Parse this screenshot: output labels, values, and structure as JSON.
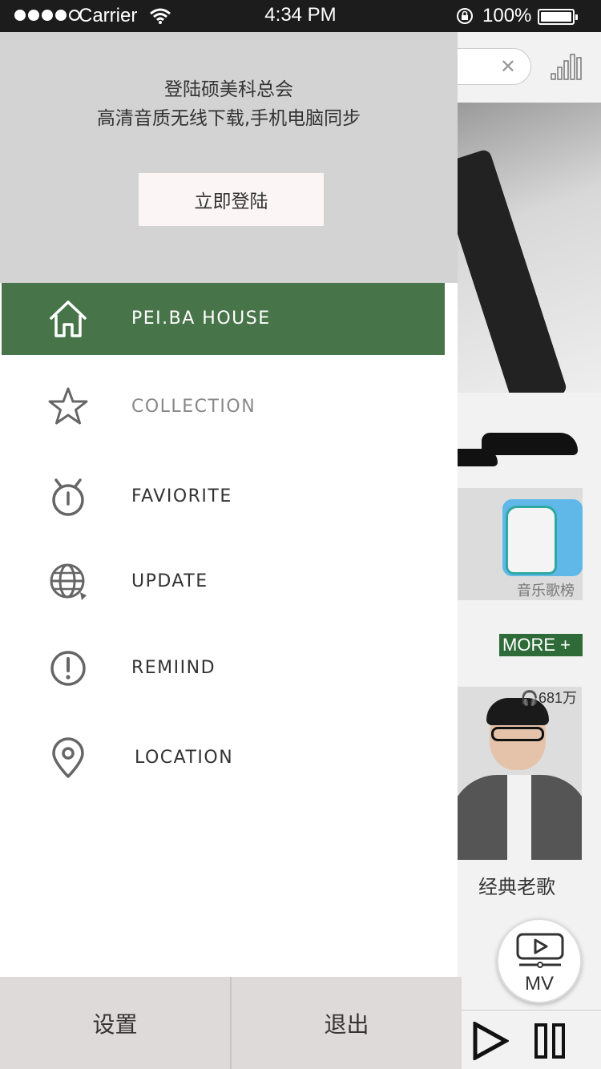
{
  "status_bar": {
    "carrier": "Carrier",
    "time": "4:34 PM",
    "battery": "100%"
  },
  "drawer": {
    "header_title": "登陆硕美科总会",
    "header_subtitle": "高清音质无线下载,手机电脑同步",
    "login_button": "立即登陆",
    "menu": [
      {
        "label": "PEI.BA HOUSE",
        "icon": "home-icon",
        "active": true
      },
      {
        "label": "COLLECTION",
        "icon": "star-icon",
        "active": false
      },
      {
        "label": "FAVIORITE",
        "icon": "alarm-clock-icon",
        "active": false
      },
      {
        "label": "UPDATE",
        "icon": "globe-refresh-icon",
        "active": false
      },
      {
        "label": "REMIIND",
        "icon": "alert-circle-icon",
        "active": false
      },
      {
        "label": "LOCATION",
        "icon": "location-pin-icon",
        "active": false
      }
    ],
    "footer": {
      "settings": "设置",
      "logout": "退出"
    }
  },
  "background": {
    "chart_card_label": "音乐歌榜",
    "more_label": "MORE",
    "album_plays": "681万",
    "album_title": "经典老歌",
    "mv_label": "MV"
  },
  "colors": {
    "accent_green": "#48744a",
    "header_gray": "#d3d3d3",
    "footer_gray": "#dedad9",
    "more_green": "#2f6b38"
  }
}
